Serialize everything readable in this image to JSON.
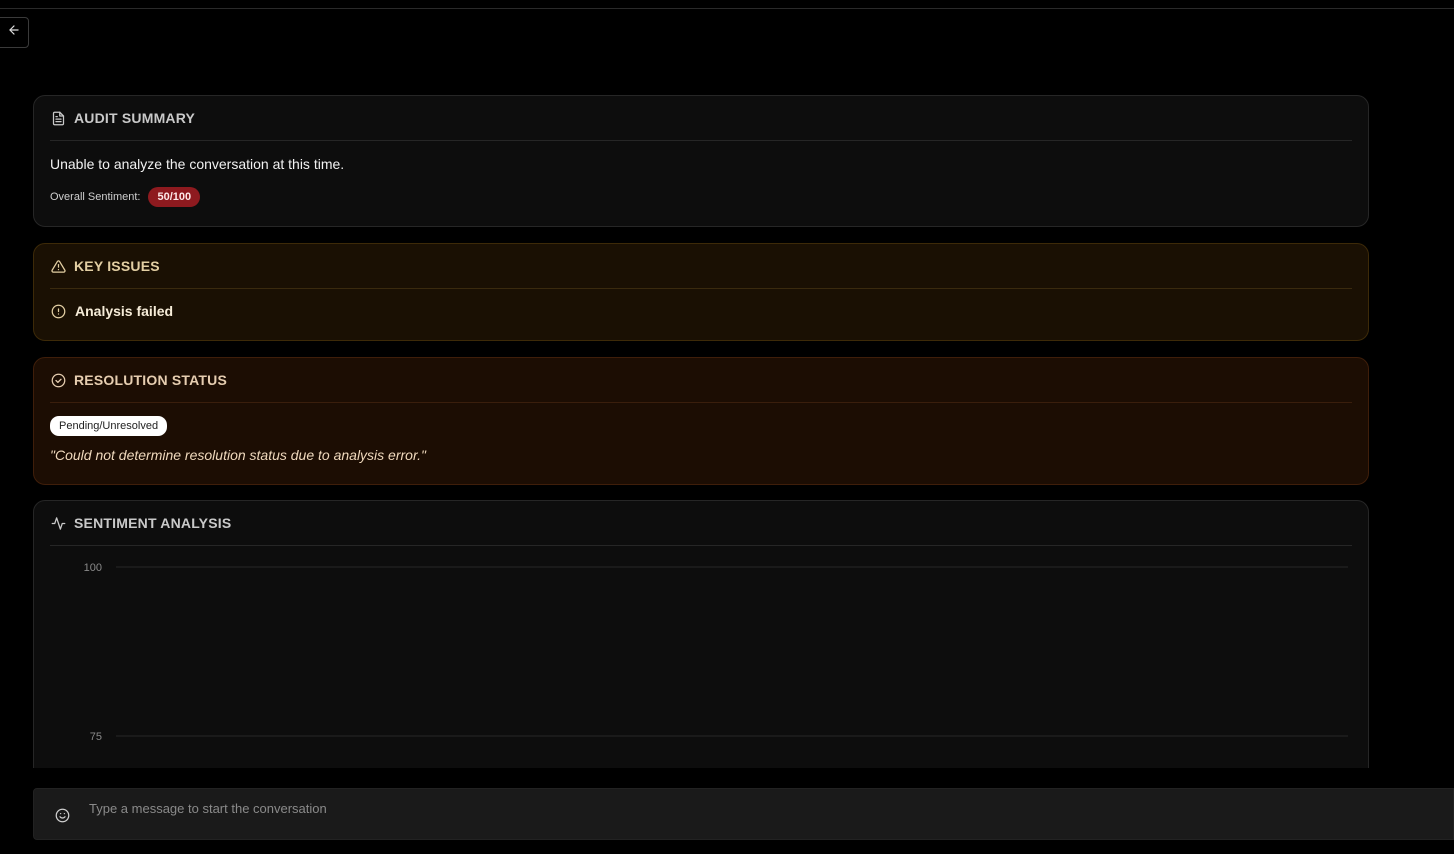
{
  "audit": {
    "title": "AUDIT SUMMARY",
    "summary": "Unable to analyze the conversation at this time.",
    "sentiment_label": "Overall Sentiment:",
    "sentiment_score": "50/100",
    "score_color": "#8e1a1f"
  },
  "issues": {
    "title": "KEY ISSUES",
    "items": [
      {
        "label": "Analysis failed"
      }
    ]
  },
  "resolution": {
    "title": "RESOLUTION STATUS",
    "status": "Pending/Unresolved",
    "note": "\"Could not determine resolution status due to analysis error.\""
  },
  "sentiment_chart": {
    "title": "SENTIMENT ANALYSIS"
  },
  "chart_data": {
    "type": "line",
    "title": "",
    "xlabel": "",
    "ylabel": "",
    "y_ticks": [
      100,
      75
    ],
    "ylim": [
      0,
      100
    ],
    "series": [],
    "grid": true
  },
  "composer": {
    "placeholder": "Type a message to start the conversation"
  },
  "icons": {
    "back": "arrow-left-icon",
    "audit": "document-icon",
    "issues": "alert-triangle-icon",
    "issue_item": "alert-circle-icon",
    "resolution": "check-circle-icon",
    "sentiment": "activity-icon",
    "composer": "smile-icon"
  },
  "colors": {
    "issues_bg": "#1a1003",
    "resolution_bg": "#1c0d03",
    "card_bg": "#0d0d0d"
  }
}
